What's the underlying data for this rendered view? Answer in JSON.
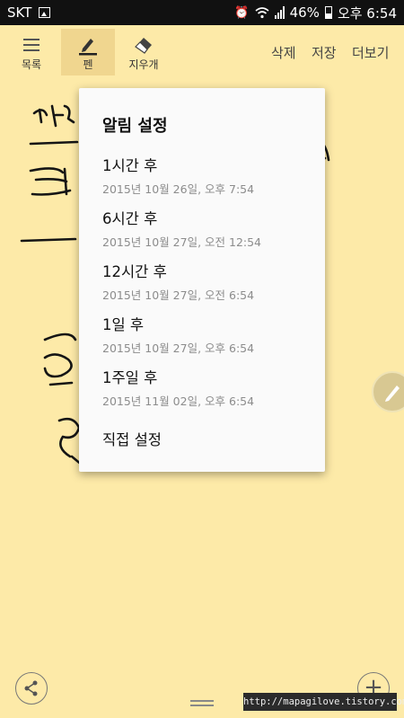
{
  "status_bar": {
    "carrier": "SKT",
    "battery": "46%",
    "time": "오후 6:54",
    "icons": [
      "gallery-notification-icon",
      "alarm-icon",
      "wifi-icon",
      "signal-icon",
      "battery-icon"
    ]
  },
  "toolbar": {
    "list_label": "목록",
    "pen_label": "펜",
    "eraser_label": "지우개",
    "delete_label": "삭제",
    "save_label": "저장",
    "more_label": "더보기"
  },
  "reminder_popup": {
    "title": "알림 설정",
    "options": [
      {
        "label": "1시간 후",
        "time": "2015년 10월 26일, 오후 7:54"
      },
      {
        "label": "6시간 후",
        "time": "2015년 10월 27일, 오전 12:54"
      },
      {
        "label": "12시간 후",
        "time": "2015년 10월 27일, 오전 6:54"
      },
      {
        "label": "1일 후",
        "time": "2015년 10월 27일, 오후 6:54"
      },
      {
        "label": "1주일 후",
        "time": "2015년 11월 02일, 오후 6:54"
      }
    ],
    "custom_label": "직접 설정"
  },
  "bottom": {
    "add_label": "+",
    "watermark": "http://mapagilove.tistory.com"
  },
  "colors": {
    "note_background": "#fdeaa8",
    "status_bar": "#111111",
    "active_tool": "#f0d68f",
    "popup": "#fafafa"
  }
}
